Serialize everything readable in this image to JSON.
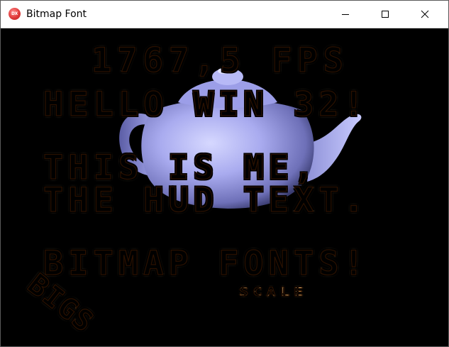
{
  "window": {
    "title": "Bitmap Font",
    "icon_label": "DX",
    "controls": {
      "minimize": "minimize-icon",
      "maximize": "maximize-icon",
      "close": "close-icon"
    }
  },
  "scene": {
    "fps_text": "1767,5 FPS",
    "lines": [
      "HELLO WIN 32!",
      "THIS IS ME,",
      "THE HUD TEXT.",
      "BITMAP FONTS!"
    ],
    "scale_text": "SCALE",
    "rotated_text": "BIGS",
    "teapot_color": "#aeb0f0"
  }
}
